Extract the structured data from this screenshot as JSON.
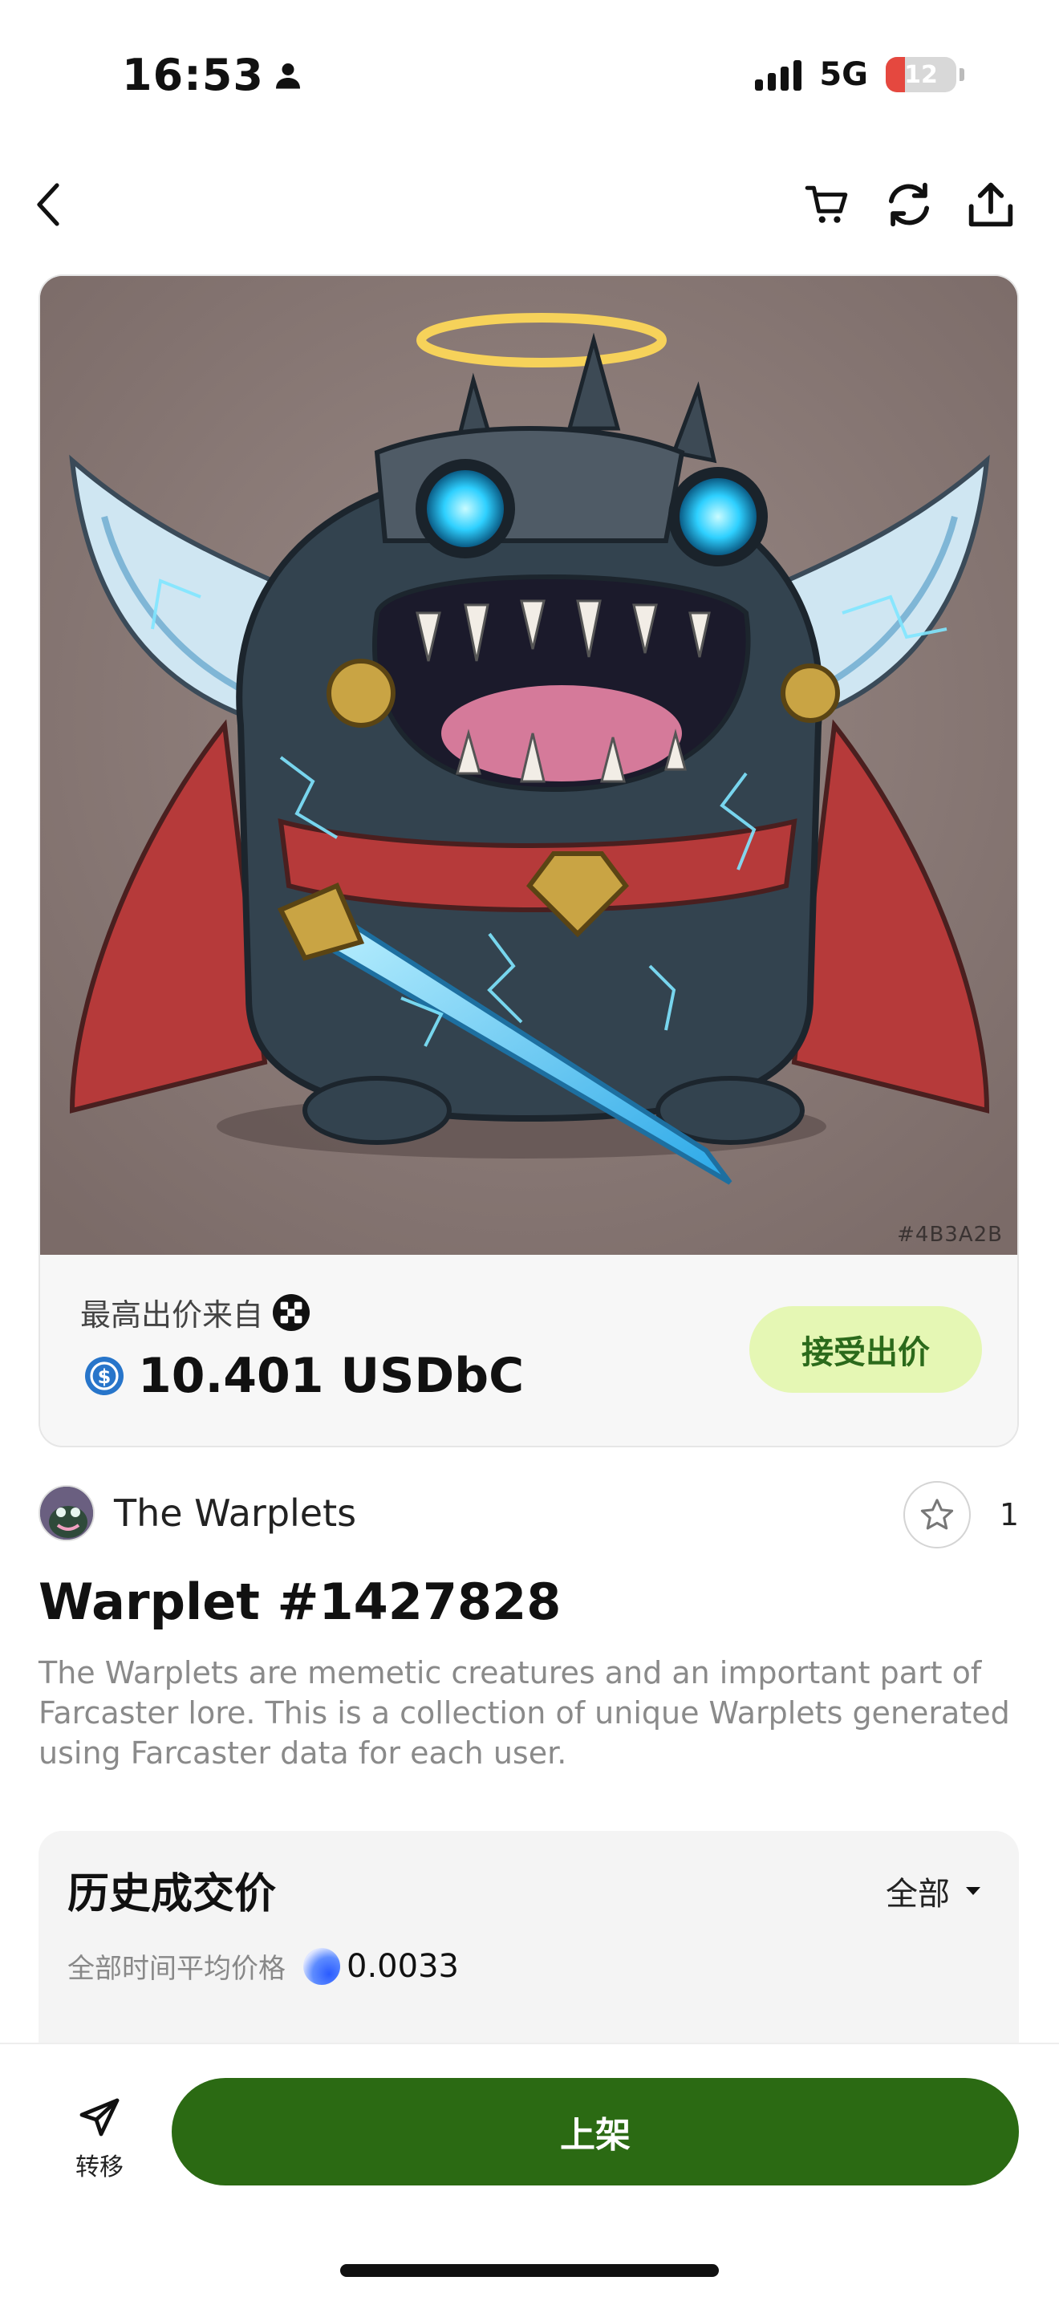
{
  "status_bar": {
    "time": "16:53",
    "network": "5G",
    "battery": "12"
  },
  "nav": {
    "back_icon": "chevron-left-icon",
    "cart_icon": "cart-icon",
    "refresh_icon": "refresh-icon",
    "share_icon": "share-icon"
  },
  "artwork": {
    "color_code": "#4B3A2B"
  },
  "offer": {
    "label": "最高出价来自",
    "price": "10.401 USDbC",
    "accept_label": "接受出价"
  },
  "collection": {
    "name": "The Warplets",
    "favorite_count": "1"
  },
  "nft": {
    "title": "Warplet #1427828",
    "description": "The Warplets are memetic creatures and an important part of Farcaster lore. This is a collection of unique Warplets generated using Farcaster data for each user."
  },
  "history": {
    "title": "历史成交价",
    "filter": "全部",
    "avg_label": "全部时间平均价格",
    "avg_value": "0.0033"
  },
  "bottom_bar": {
    "transfer_label": "转移",
    "list_label": "上架"
  },
  "colors": {
    "primary_green": "#2b6a13",
    "accept_bg": "#e5f7b4",
    "accept_text": "#2b6a1b",
    "usdc_blue": "#2775ca"
  }
}
